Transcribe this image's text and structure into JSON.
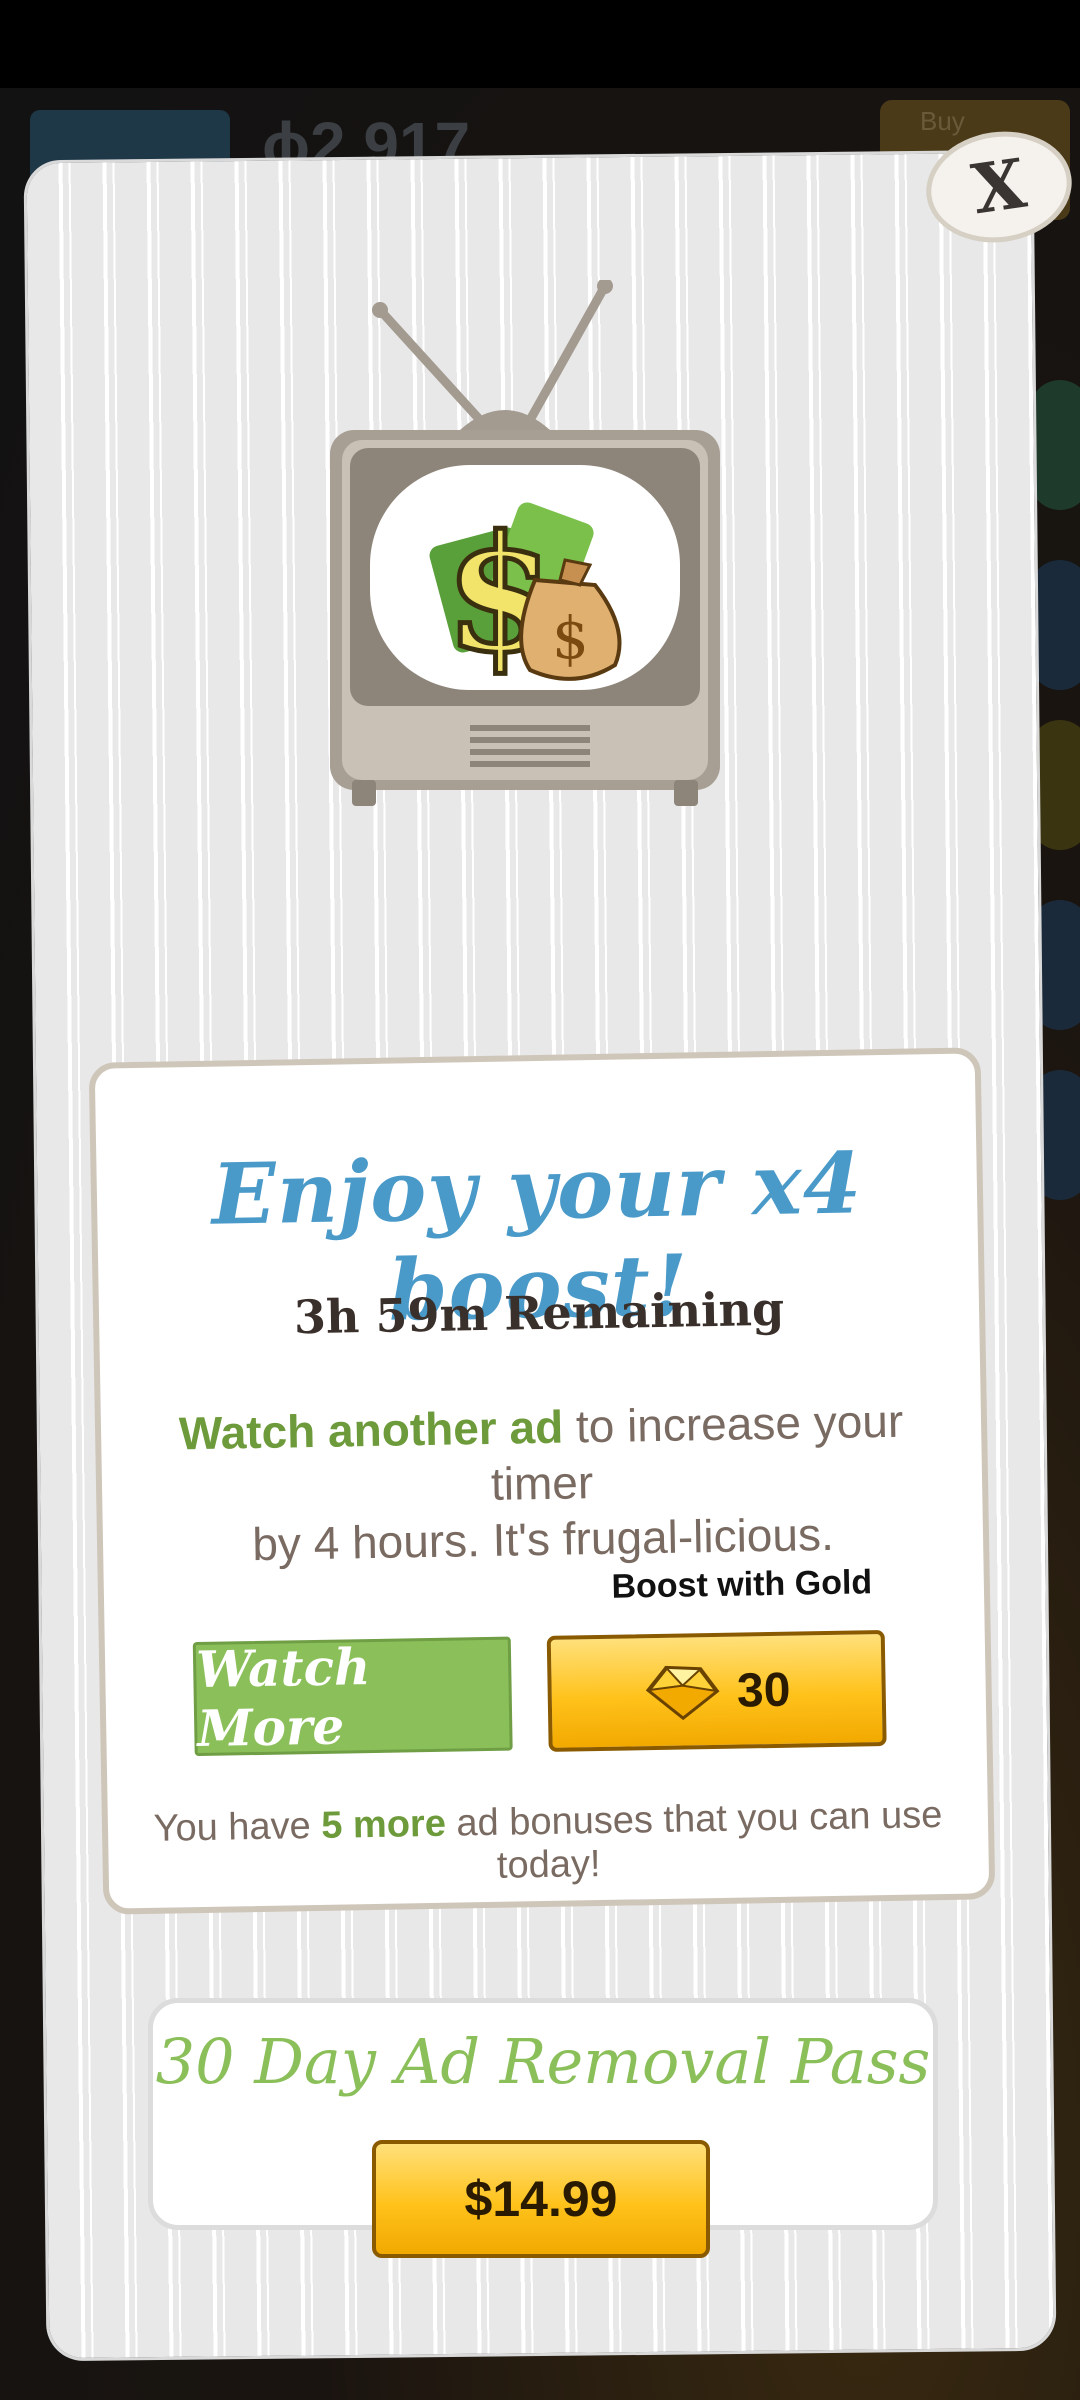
{
  "background": {
    "coins": "ϕ2,917",
    "buy": "Buy"
  },
  "dialog": {
    "close_label": "X",
    "title": "Enjoy your x4 boost!",
    "remaining": "3h 59m Remaining",
    "description": {
      "highlight": "Watch another ad",
      "line1_rest": " to increase your timer",
      "line2": "by 4 hours. It's frugal-licious."
    },
    "gold_label": "Boost with Gold",
    "watch_more": "Watch More",
    "gold_cost": "30",
    "bonus": {
      "prefix": "You have ",
      "count": "5 more",
      "suffix": " ad bonuses that you can use today!"
    },
    "pass_title": "30 Day Ad Removal Pass",
    "price": "$14.99"
  },
  "colors": {
    "title_blue": "#4a9ac9",
    "accent_green": "#8bbf5a",
    "gold": "#ffc21b"
  },
  "icons": [
    "close-icon",
    "tv-icon",
    "money-bag-icon",
    "gold-gem-icon"
  ]
}
